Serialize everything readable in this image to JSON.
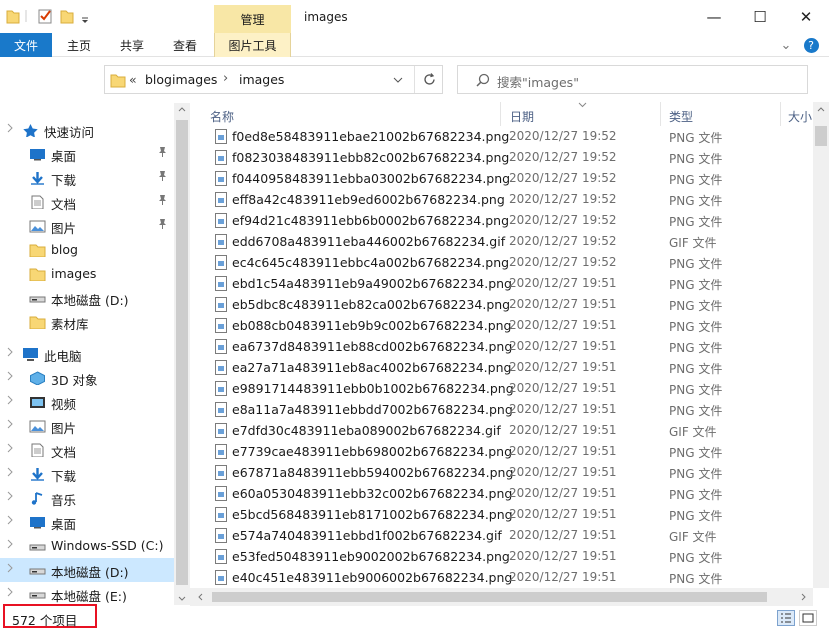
{
  "window": {
    "title": "images",
    "manage_tab": "管理",
    "minimize": "—",
    "maximize": "☐",
    "close": "✕"
  },
  "ribbon": {
    "tabs": [
      "文件",
      "主页",
      "共享",
      "查看",
      "图片工具"
    ],
    "help": "?",
    "expand": "⌄"
  },
  "address": {
    "prefix": "«",
    "crumbs": [
      "blogimages",
      "images"
    ],
    "separator": "›",
    "search_placeholder": "搜索\"images\""
  },
  "nav": {
    "quick_access": "快速访问",
    "items": [
      {
        "label": "桌面",
        "icon": "desktop-icon",
        "pinned": true
      },
      {
        "label": "下载",
        "icon": "download-icon",
        "pinned": true
      },
      {
        "label": "文档",
        "icon": "document-icon",
        "pinned": true
      },
      {
        "label": "图片",
        "icon": "pictures-icon",
        "pinned": true
      },
      {
        "label": "blog",
        "icon": "folder-icon",
        "pinned": false
      },
      {
        "label": "images",
        "icon": "folder-icon",
        "pinned": false
      },
      {
        "label": "本地磁盘 (D:)",
        "icon": "drive-icon",
        "pinned": false
      },
      {
        "label": "素材库",
        "icon": "folder-icon",
        "pinned": false
      }
    ],
    "this_pc": "此电脑",
    "pc_items": [
      {
        "label": "3D 对象",
        "icon": "3d-objects-icon"
      },
      {
        "label": "视频",
        "icon": "video-icon"
      },
      {
        "label": "图片",
        "icon": "pictures-icon"
      },
      {
        "label": "文档",
        "icon": "document-icon"
      },
      {
        "label": "下载",
        "icon": "download-icon"
      },
      {
        "label": "音乐",
        "icon": "music-icon"
      },
      {
        "label": "桌面",
        "icon": "desktop-icon"
      },
      {
        "label": "Windows-SSD (C:)",
        "icon": "drive-icon"
      },
      {
        "label": "本地磁盘 (D:)",
        "icon": "drive-icon",
        "selected": true
      },
      {
        "label": "本地磁盘 (E:)",
        "icon": "drive-icon"
      }
    ]
  },
  "columns": {
    "name": "名称",
    "date": "日期",
    "type": "类型",
    "size": "大小"
  },
  "files": [
    {
      "name": "f0ed8e58483911ebae21002b67682234.png",
      "date": "2020/12/27 19:52",
      "type": "PNG 文件"
    },
    {
      "name": "f0823038483911ebb82c002b67682234.png",
      "date": "2020/12/27 19:52",
      "type": "PNG 文件"
    },
    {
      "name": "f0440958483911ebba03002b67682234.png",
      "date": "2020/12/27 19:52",
      "type": "PNG 文件"
    },
    {
      "name": "eff8a42c483911eb9ed6002b67682234.png",
      "date": "2020/12/27 19:52",
      "type": "PNG 文件"
    },
    {
      "name": "ef94d21c483911ebb6b0002b67682234.png",
      "date": "2020/12/27 19:52",
      "type": "PNG 文件"
    },
    {
      "name": "edd6708a483911eba446002b67682234.gif",
      "date": "2020/12/27 19:52",
      "type": "GIF 文件"
    },
    {
      "name": "ec4c645c483911ebbc4a002b67682234.png",
      "date": "2020/12/27 19:52",
      "type": "PNG 文件"
    },
    {
      "name": "ebd1c54a483911eb9a49002b67682234.png",
      "date": "2020/12/27 19:51",
      "type": "PNG 文件"
    },
    {
      "name": "eb5dbc8c483911eb82ca002b67682234.png",
      "date": "2020/12/27 19:51",
      "type": "PNG 文件"
    },
    {
      "name": "eb088cb0483911eb9b9c002b67682234.png",
      "date": "2020/12/27 19:51",
      "type": "PNG 文件"
    },
    {
      "name": "ea6737d8483911eb88cd002b67682234.png",
      "date": "2020/12/27 19:51",
      "type": "PNG 文件"
    },
    {
      "name": "ea27a71a483911eb8ac4002b67682234.png",
      "date": "2020/12/27 19:51",
      "type": "PNG 文件"
    },
    {
      "name": "e9891714483911ebb0b1002b67682234.png",
      "date": "2020/12/27 19:51",
      "type": "PNG 文件"
    },
    {
      "name": "e8a11a7a483911ebbdd7002b67682234.png",
      "date": "2020/12/27 19:51",
      "type": "PNG 文件"
    },
    {
      "name": "e7dfd30c483911eba089002b67682234.gif",
      "date": "2020/12/27 19:51",
      "type": "GIF 文件"
    },
    {
      "name": "e7739cae483911ebb698002b67682234.png",
      "date": "2020/12/27 19:51",
      "type": "PNG 文件"
    },
    {
      "name": "e67871a8483911ebb594002b67682234.png",
      "date": "2020/12/27 19:51",
      "type": "PNG 文件"
    },
    {
      "name": "e60a0530483911ebb32c002b67682234.png",
      "date": "2020/12/27 19:51",
      "type": "PNG 文件"
    },
    {
      "name": "e5bcd568483911eb8171002b67682234.png",
      "date": "2020/12/27 19:51",
      "type": "PNG 文件"
    },
    {
      "name": "e574a740483911ebbd1f002b67682234.gif",
      "date": "2020/12/27 19:51",
      "type": "GIF 文件"
    },
    {
      "name": "e53fed50483911eb9002002b67682234.png",
      "date": "2020/12/27 19:51",
      "type": "PNG 文件"
    },
    {
      "name": "e40c451e483911eb9006002b67682234.png",
      "date": "2020/12/27 19:51",
      "type": "PNG 文件"
    }
  ],
  "status": {
    "count": "572 个项目"
  },
  "colors": {
    "file_tab": "#1979ca",
    "manage_tab": "#f8e7a6",
    "selection": "#cce8ff",
    "highlight_box": "#e81123"
  }
}
